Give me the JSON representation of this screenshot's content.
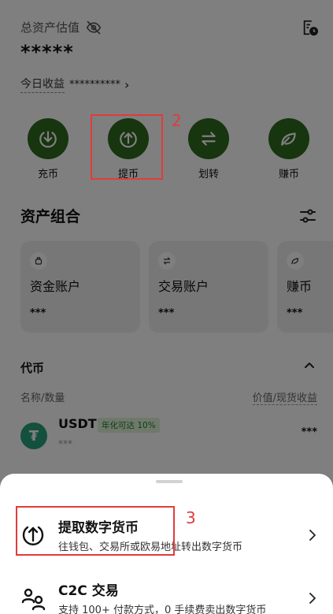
{
  "header": {
    "total_assets_label": "总资产估值",
    "total_assets_value": "*****",
    "today_label": "今日收益",
    "today_value": "**********",
    "today_chevron": "›"
  },
  "actions": [
    {
      "label": "充币",
      "icon": "deposit-icon"
    },
    {
      "label": "提币",
      "icon": "withdraw-icon"
    },
    {
      "label": "划转",
      "icon": "transfer-icon"
    },
    {
      "label": "赚币",
      "icon": "earn-icon"
    }
  ],
  "annotations": {
    "step_2": "2",
    "step_3": "3",
    "color": "#e23b3b"
  },
  "portfolio": {
    "title": "资产组合",
    "cards": [
      {
        "name": "资金账户",
        "value": "***",
        "icon": "wallet-icon"
      },
      {
        "name": "交易账户",
        "value": "***",
        "icon": "exchange-icon"
      },
      {
        "name": "赚币",
        "value": "***",
        "icon": "leaf-icon"
      }
    ]
  },
  "tokens": {
    "title": "代币",
    "col_left": "名称/数量",
    "col_right": "价值/现货收益",
    "items": [
      {
        "symbol": "USDT",
        "badge": "年化可达 10%",
        "amount": "***",
        "value": "***"
      }
    ]
  },
  "sheet": {
    "options": [
      {
        "title": "提取数字货币",
        "desc": "往钱包、交易所或欧易地址转出数字货币",
        "icon": "withdraw-arrow-icon"
      },
      {
        "title": "C2C 交易",
        "desc": "支持 100+ 付款方式，0 手续费卖出数字货币",
        "icon": "c2c-users-icon"
      }
    ]
  },
  "colors": {
    "brand_green": "#2f6b1c",
    "usdt_green": "#26a17b",
    "badge_text": "#1e7a2a",
    "badge_bg": "#dff3d6"
  }
}
